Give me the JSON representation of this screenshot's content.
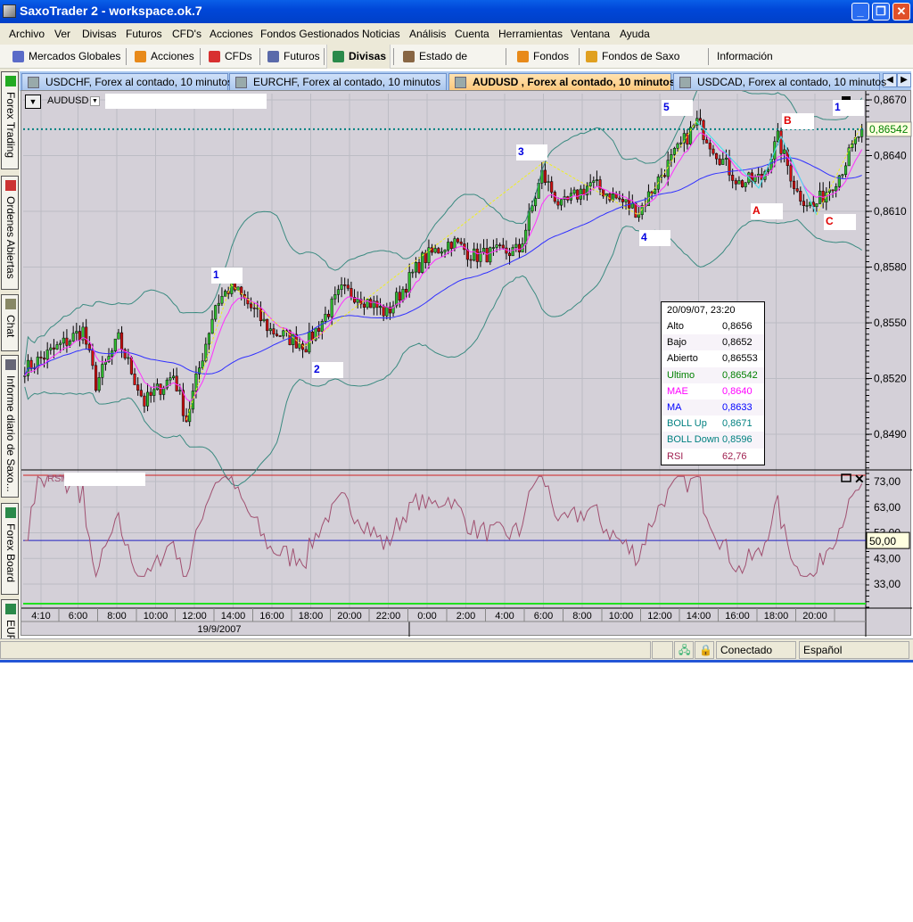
{
  "window": {
    "title": "SaxoTrader 2 - workspace.ok.7",
    "minimize": "_",
    "restore": "❐",
    "close": "✕"
  },
  "menu": [
    "Archivo",
    "Ver",
    "Divisas",
    "Futuros",
    "CFD's",
    "Acciones",
    "Fondos Gestionados",
    "Noticias",
    "Análisis",
    "Cuenta",
    "Herramientas",
    "Ventana",
    "Ayuda"
  ],
  "toolbar": [
    {
      "label": "Mercados Globales",
      "icon": "gear-icon",
      "color": "#5a6bc8"
    },
    {
      "label": "Acciones",
      "icon": "stocks-icon",
      "color": "#e88a1a"
    },
    {
      "label": "CFDs",
      "icon": "cfd-icon",
      "color": "#d83030"
    },
    {
      "label": "Futuros",
      "icon": "futures-icon",
      "color": "#5a6aaa"
    },
    {
      "label": "Divisas",
      "icon": "forex-icon",
      "color": "#2a8a4a",
      "active": true
    },
    {
      "label": "Estado de Cuenta",
      "icon": "account-icon",
      "color": "#886644"
    },
    {
      "label": "Fondos",
      "icon": "funds-icon",
      "color": "#e88a1a"
    },
    {
      "label": "Fondos de Saxo Bank",
      "icon": "saxo-funds-icon",
      "color": "#e0a020"
    },
    {
      "label": "Información",
      "icon": "",
      "color": ""
    }
  ],
  "sidebar": [
    "Forex Trading",
    "Ordenes Abiertas",
    "Chat",
    "Informe diario de Saxo...",
    "Forex Board",
    "EURC"
  ],
  "chart_tabs": [
    {
      "label": "USDCHF, Forex al contado, 10 minutos"
    },
    {
      "label": "EURCHF, Forex al contado, 10 minutos"
    },
    {
      "label": "AUDUSD , Forex al contado, 10 minutos",
      "active": true
    },
    {
      "label": "USDCAD, Forex al contado, 10 minutos"
    }
  ],
  "chart": {
    "symbol": "AUDUSD",
    "rsi_label": "RSI",
    "last_price": "0,86542",
    "price_ticks": [
      "0,8670",
      "0,8640",
      "0,8610",
      "0,8580",
      "0,8550",
      "0,8520",
      "0,8490"
    ],
    "price_tick_values": [
      0.867,
      0.864,
      0.861,
      0.858,
      0.855,
      0.852,
      0.849
    ],
    "rsi_ticks": [
      "73,00",
      "63,00",
      "53,00",
      "43,00",
      "33,00"
    ],
    "rsi_tick_values": [
      73,
      63,
      53,
      43,
      33
    ],
    "rsi_level": "50,00",
    "time_ticks": [
      "4:10",
      "6:00",
      "8:00",
      "10:00",
      "12:00",
      "14:00",
      "16:00",
      "18:00",
      "20:00",
      "22:00",
      "0:00",
      "2:00",
      "4:00",
      "6:00",
      "8:00",
      "10:00",
      "12:00",
      "14:00",
      "16:00",
      "18:00",
      "20:00"
    ],
    "date_label": "19/9/2007",
    "waves": [
      "1",
      "2",
      "3",
      "4",
      "5",
      "1"
    ],
    "corrective": [
      "A",
      "B",
      "C"
    ],
    "waypoints": [
      [
        0,
        0.8526
      ],
      [
        1,
        0.8526
      ],
      [
        18,
        0.8546
      ],
      [
        22,
        0.8517
      ],
      [
        29,
        0.8541
      ],
      [
        37,
        0.8507
      ],
      [
        46,
        0.8522
      ],
      [
        50,
        0.8498
      ],
      [
        59,
        0.856
      ],
      [
        64,
        0.857
      ],
      [
        76,
        0.8546
      ],
      [
        87,
        0.8538
      ],
      [
        98,
        0.8567
      ],
      [
        103,
        0.8565
      ],
      [
        112,
        0.8555
      ],
      [
        123,
        0.8584
      ],
      [
        132,
        0.8594
      ],
      [
        139,
        0.8586
      ],
      [
        153,
        0.8589
      ],
      [
        160,
        0.863
      ],
      [
        166,
        0.8612
      ],
      [
        175,
        0.8625
      ],
      [
        190,
        0.861
      ],
      [
        197,
        0.863
      ],
      [
        208,
        0.8658
      ],
      [
        214,
        0.8642
      ],
      [
        221,
        0.8625
      ],
      [
        228,
        0.8628
      ],
      [
        233,
        0.8649
      ],
      [
        239,
        0.862
      ],
      [
        244,
        0.8612
      ],
      [
        252,
        0.863
      ],
      [
        259,
        0.86542
      ]
    ],
    "colors": {
      "up": "#30c030",
      "down": "#d01010",
      "mae": "#ff30ff",
      "ma": "#3030ff",
      "boll": "#3a8a80",
      "rsi": "#a05070",
      "last": "#008080"
    }
  },
  "infobox": {
    "datetime": "20/09/07, 23:20",
    "rows": [
      {
        "k": "Alto",
        "v": "0,8656",
        "color": "#000"
      },
      {
        "k": "Bajo",
        "v": "0,8652",
        "color": "#000"
      },
      {
        "k": "Abierto",
        "v": "0,86553",
        "color": "#000"
      },
      {
        "k": "Ultimo",
        "v": "0,86542",
        "color": "#008000"
      },
      {
        "k": "MAE",
        "v": "0,8640",
        "color": "#ff00ff"
      },
      {
        "k": "MA",
        "v": "0,8633",
        "color": "#0000ff"
      },
      {
        "k": "BOLL Up",
        "v": "0,8671",
        "color": "#008080"
      },
      {
        "k": "BOLL Down",
        "v": "0,8596",
        "color": "#008080"
      },
      {
        "k": "RSI",
        "v": "62,76",
        "color": "#a02050"
      }
    ]
  },
  "status": {
    "connection": "Conectado",
    "language": "Español"
  }
}
